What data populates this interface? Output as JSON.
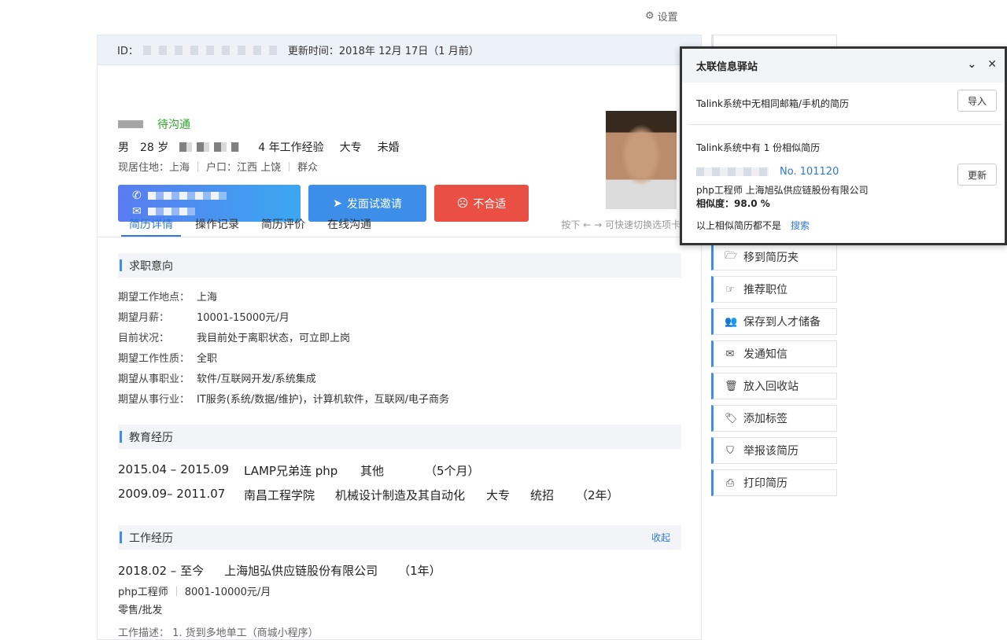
{
  "settings": {
    "label": "设置"
  },
  "id_bar": {
    "id_label": "ID：",
    "updated": "更新时间：2018年 12月 17日（1 月前）"
  },
  "profile": {
    "status": "待沟通",
    "gender": "男",
    "age": "28 岁",
    "experience": "4 年工作经验",
    "degree": "大专",
    "marital": "未婚",
    "residence": "现居住地：上海",
    "hukou": "户口：江西 上饶",
    "politics": "群众"
  },
  "actions": {
    "invite": "发面试邀请",
    "reject": "不合适"
  },
  "tabs": [
    {
      "label": "简历详情"
    },
    {
      "label": "操作记录"
    },
    {
      "label": "简历评价"
    },
    {
      "label": "在线沟通"
    }
  ],
  "tab_hint": "按下 ← → 可快速切换选项卡",
  "job_intent": {
    "title": "求职意向",
    "rows": [
      {
        "k": "期望工作地点：",
        "v": "上海"
      },
      {
        "k": "期望月薪：",
        "v": "10001-15000元/月"
      },
      {
        "k": "目前状况：",
        "v": "我目前处于离职状态，可立即上岗"
      },
      {
        "k": "期望工作性质：",
        "v": "全职"
      },
      {
        "k": "期望从事职业：",
        "v": "软件/互联网开发/系统集成"
      },
      {
        "k": "期望从事行业：",
        "v": "IT服务(系统/数据/维护)，计算机软件，互联网/电子商务"
      }
    ]
  },
  "education": {
    "title": "教育经历",
    "rows": [
      {
        "period": "2015.04 – 2015.09",
        "school": "LAMP兄弟连 php",
        "major": "其他",
        "degree": "",
        "type": "",
        "duration": "（5个月）"
      },
      {
        "period": "2009.09– 2011.07",
        "school": "南昌工程学院",
        "major": "机械设计制造及其自动化",
        "degree": "大专",
        "type": "统招",
        "duration": "（2年）"
      }
    ]
  },
  "work": {
    "title": "工作经历",
    "collapse": "收起",
    "period": "2018.02 – 至今",
    "company": "上海旭弘供应链股份有限公司",
    "duration": "（1年）",
    "position": "php工程师",
    "salary": "8001-10000元/月",
    "industry": "零售/批发",
    "desc": "工作描述：   1.     货到多地单工（商城小程序）"
  },
  "sidebar": [
    {
      "label": "移到简历夹",
      "icon": "folder-icon"
    },
    {
      "label": "推荐职位",
      "icon": "thumbs-up-icon"
    },
    {
      "label": "保存到人才储备",
      "icon": "users-icon"
    },
    {
      "label": "发通知信",
      "icon": "mail-icon"
    },
    {
      "label": "放入回收站",
      "icon": "trash-icon"
    },
    {
      "label": "添加标签",
      "icon": "tag-icon"
    },
    {
      "label": "举报该简历",
      "icon": "shield-icon"
    },
    {
      "label": "打印简历",
      "icon": "printer-icon"
    }
  ],
  "popup": {
    "title": "太联信息驿站",
    "no_match": "Talink系统中无相同邮箱/手机的简历",
    "import": "导入",
    "similar": "Talink系统中有 1 份相似简历",
    "number": "No. 101120",
    "update": "更新",
    "job_company": "php工程师    上海旭弘供应链股份有限公司",
    "similarity": "相似度：98.0 %",
    "none_text": "以上相似简历都不是",
    "search": "搜索"
  },
  "colors": {
    "accent": "#3c8ee8",
    "danger": "#ea4f43",
    "status": "#2ca52c"
  }
}
